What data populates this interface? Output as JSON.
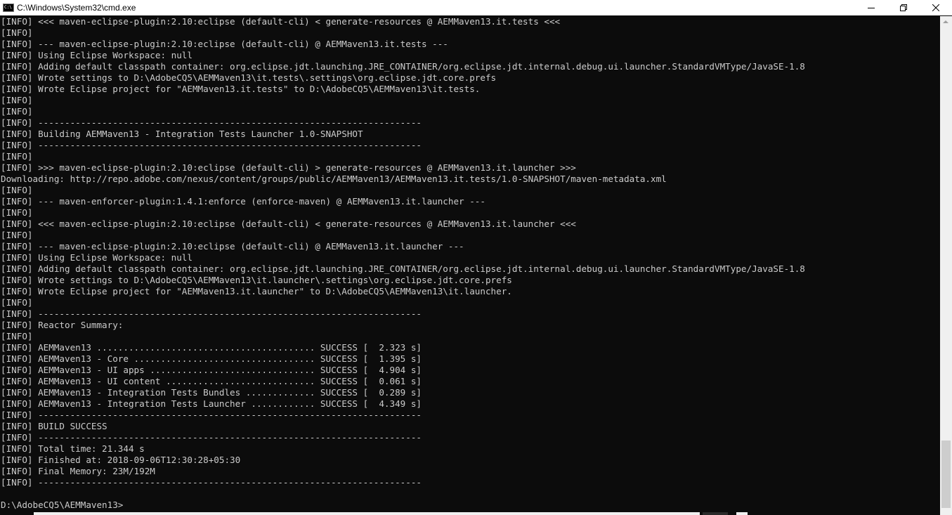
{
  "window": {
    "title": "C:\\Windows\\System32\\cmd.exe",
    "icon": "cmd-icon",
    "icon_text": "C:\\",
    "controls": [
      "minimize-icon",
      "maximize-icon",
      "close-icon"
    ]
  },
  "colors": {
    "console_bg": "#0c0c0c",
    "console_text": "#cccccc",
    "titlebar_bg": "#ffffff"
  },
  "console": {
    "lines": [
      "[INFO] <<< maven-eclipse-plugin:2.10:eclipse (default-cli) < generate-resources @ AEMMaven13.it.tests <<<",
      "[INFO]",
      "[INFO] --- maven-eclipse-plugin:2.10:eclipse (default-cli) @ AEMMaven13.it.tests ---",
      "[INFO] Using Eclipse Workspace: null",
      "[INFO] Adding default classpath container: org.eclipse.jdt.launching.JRE_CONTAINER/org.eclipse.jdt.internal.debug.ui.launcher.StandardVMType/JavaSE-1.8",
      "[INFO] Wrote settings to D:\\AdobeCQ5\\AEMMaven13\\it.tests\\.settings\\org.eclipse.jdt.core.prefs",
      "[INFO] Wrote Eclipse project for \"AEMMaven13.it.tests\" to D:\\AdobeCQ5\\AEMMaven13\\it.tests.",
      "[INFO]",
      "[INFO]",
      "[INFO] ------------------------------------------------------------------------",
      "[INFO] Building AEMMaven13 - Integration Tests Launcher 1.0-SNAPSHOT",
      "[INFO] ------------------------------------------------------------------------",
      "[INFO]",
      "[INFO] >>> maven-eclipse-plugin:2.10:eclipse (default-cli) > generate-resources @ AEMMaven13.it.launcher >>>",
      "Downloading: http://repo.adobe.com/nexus/content/groups/public/AEMMaven13/AEMMaven13.it.tests/1.0-SNAPSHOT/maven-metadata.xml",
      "[INFO]",
      "[INFO] --- maven-enforcer-plugin:1.4.1:enforce (enforce-maven) @ AEMMaven13.it.launcher ---",
      "[INFO]",
      "[INFO] <<< maven-eclipse-plugin:2.10:eclipse (default-cli) < generate-resources @ AEMMaven13.it.launcher <<<",
      "[INFO]",
      "[INFO] --- maven-eclipse-plugin:2.10:eclipse (default-cli) @ AEMMaven13.it.launcher ---",
      "[INFO] Using Eclipse Workspace: null",
      "[INFO] Adding default classpath container: org.eclipse.jdt.launching.JRE_CONTAINER/org.eclipse.jdt.internal.debug.ui.launcher.StandardVMType/JavaSE-1.8",
      "[INFO] Wrote settings to D:\\AdobeCQ5\\AEMMaven13\\it.launcher\\.settings\\org.eclipse.jdt.core.prefs",
      "[INFO] Wrote Eclipse project for \"AEMMaven13.it.launcher\" to D:\\AdobeCQ5\\AEMMaven13\\it.launcher.",
      "[INFO]",
      "[INFO] ------------------------------------------------------------------------",
      "[INFO] Reactor Summary:",
      "[INFO]",
      "[INFO] AEMMaven13 ......................................... SUCCESS [  2.323 s]",
      "[INFO] AEMMaven13 - Core .................................. SUCCESS [  1.395 s]",
      "[INFO] AEMMaven13 - UI apps ............................... SUCCESS [  4.904 s]",
      "[INFO] AEMMaven13 - UI content ............................ SUCCESS [  0.061 s]",
      "[INFO] AEMMaven13 - Integration Tests Bundles ............. SUCCESS [  0.289 s]",
      "[INFO] AEMMaven13 - Integration Tests Launcher ............ SUCCESS [  4.349 s]",
      "[INFO] ------------------------------------------------------------------------",
      "[INFO] BUILD SUCCESS",
      "[INFO] ------------------------------------------------------------------------",
      "[INFO] Total time: 21.344 s",
      "[INFO] Finished at: 2018-09-06T12:30:28+05:30",
      "[INFO] Final Memory: 23M/192M",
      "[INFO] ------------------------------------------------------------------------",
      "",
      "D:\\AdobeCQ5\\AEMMaven13>"
    ]
  }
}
